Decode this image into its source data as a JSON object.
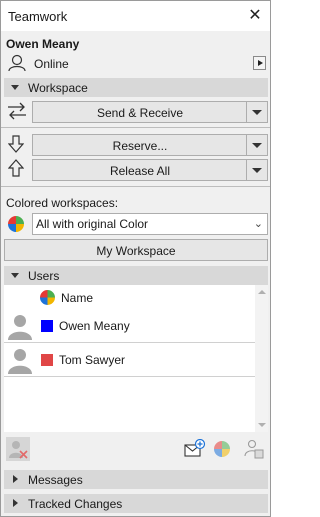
{
  "window": {
    "title": "Teamwork"
  },
  "user": {
    "name": "Owen Meany",
    "status": "Online"
  },
  "workspace": {
    "section_label": "Workspace",
    "send_receive": "Send & Receive",
    "reserve": "Reserve...",
    "release_all": "Release All"
  },
  "colored": {
    "label": "Colored workspaces:",
    "selected": "All with original Color",
    "my_workspace": "My Workspace"
  },
  "users": {
    "section_label": "Users",
    "column_header": "Name",
    "rows": [
      {
        "name": "Owen Meany",
        "color": "#0000ff"
      },
      {
        "name": "Tom Sawyer",
        "color": "#e04646"
      }
    ]
  },
  "sections": {
    "messages": "Messages",
    "tracked_changes": "Tracked Changes"
  }
}
